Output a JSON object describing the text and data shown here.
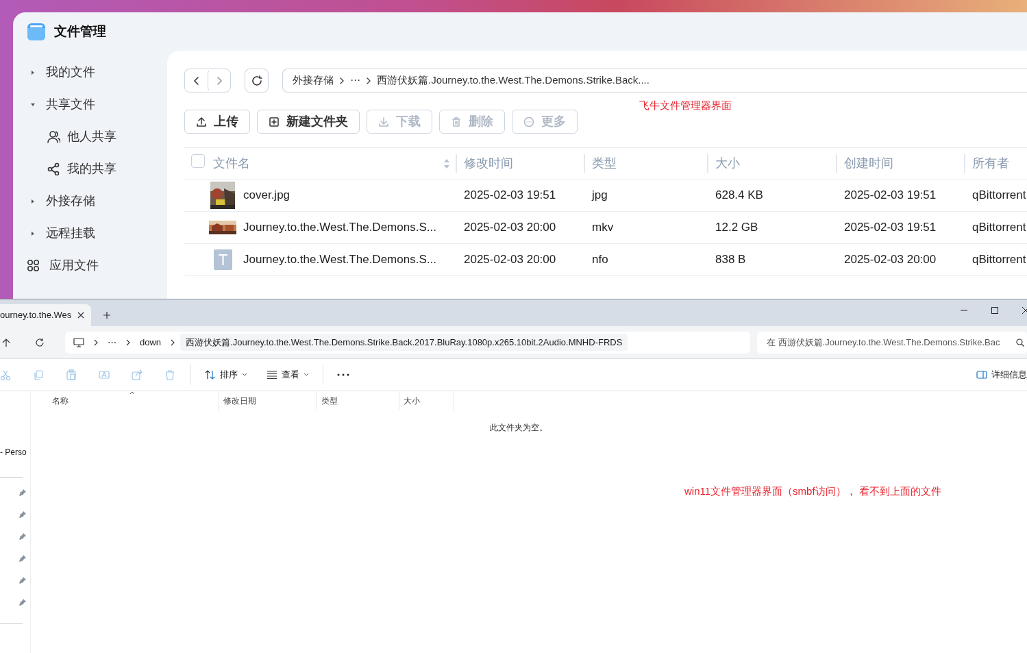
{
  "app": {
    "title": "文件管理"
  },
  "sidebar": {
    "items": [
      {
        "label": "我的文件",
        "kind": "group",
        "expanded": false
      },
      {
        "label": "共享文件",
        "kind": "group",
        "expanded": true,
        "children": [
          {
            "label": "他人共享",
            "kind": "people"
          },
          {
            "label": "我的共享",
            "kind": "share"
          }
        ]
      },
      {
        "label": "外接存储",
        "kind": "group",
        "expanded": false
      },
      {
        "label": "远程挂载",
        "kind": "group",
        "expanded": false
      },
      {
        "label": "应用文件",
        "kind": "apps"
      }
    ]
  },
  "path": [
    "外接存储",
    "⋯",
    "西游伏妖篇.Journey.to.the.West.The.Demons.Strike.Back...."
  ],
  "actions": [
    {
      "label": "上传",
      "kind": "upload",
      "disabled": false
    },
    {
      "label": "新建文件夹",
      "kind": "new-folder",
      "disabled": false
    },
    {
      "label": "下载",
      "kind": "download",
      "disabled": true
    },
    {
      "label": "删除",
      "kind": "delete",
      "disabled": true
    },
    {
      "label": "更多",
      "kind": "more",
      "disabled": true
    }
  ],
  "top_annotation": "飞牛文件管理器界面",
  "table": {
    "select_all": {
      "checked": false
    },
    "columns": [
      "文件名",
      "修改时间",
      "类型",
      "大小",
      "创建时间",
      "所有者"
    ],
    "rows": [
      {
        "kind": "picture",
        "name": "cover.jpg",
        "modified": "2025-02-03 19:51",
        "type": "jpg",
        "size": "628.4 KB",
        "created": "2025-02-03 19:51",
        "owner": "qBittorrent"
      },
      {
        "kind": "video",
        "name": "Journey.to.the.West.The.Demons.S...",
        "modified": "2025-02-03 20:00",
        "type": "mkv",
        "size": "12.2 GB",
        "created": "2025-02-03 19:51",
        "owner": "qBittorrent"
      },
      {
        "kind": "text",
        "name": "Journey.to.the.West.The.Demons.S...",
        "modified": "2025-02-03 20:00",
        "type": "nfo",
        "size": "838 B",
        "created": "2025-02-03 20:00",
        "owner": "qBittorrent"
      }
    ]
  },
  "explorer": {
    "tab_title": "ourney.to.the.Wes",
    "breadcrumb": [
      "⋯",
      "down",
      "西游伏妖篇.Journey.to.the.West.The.Demons.Strike.Back.2017.BluRay.1080p.x265.10bit.2Audio.MNHD-FRDS"
    ],
    "search": {
      "placeholder": "在 西游伏妖篇.Journey.to.the.West.The.Demons.Strike.Bac"
    },
    "edit_buttons": [
      {
        "kind": "cut",
        "disabled": true
      },
      {
        "kind": "copy",
        "disabled": true
      },
      {
        "kind": "paste",
        "disabled": true
      },
      {
        "kind": "rename",
        "disabled": true
      },
      {
        "kind": "share",
        "disabled": true
      },
      {
        "kind": "delete",
        "disabled": true
      }
    ],
    "commands": [
      {
        "label": "排序",
        "kind": "sort"
      },
      {
        "label": "查看",
        "kind": "view"
      }
    ],
    "details": "详细信息",
    "nav_item": "- Perso",
    "pins": [
      {
        "pinned": true
      },
      {
        "pinned": true
      },
      {
        "pinned": true
      },
      {
        "pinned": true
      },
      {
        "pinned": true
      },
      {
        "pinned": true
      }
    ],
    "columns": [
      "名称",
      "修改日期",
      "类型",
      "大小"
    ],
    "empty_message": "此文件夹为空。",
    "annotation": "win11文件管理器界面（smbf访问）， 看不到上面的文件"
  }
}
